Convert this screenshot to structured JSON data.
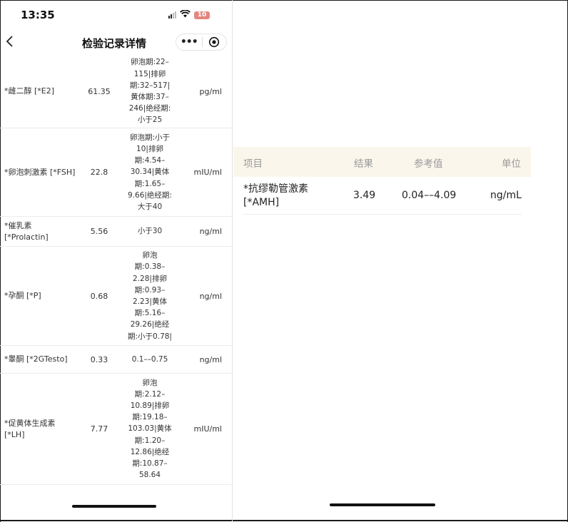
{
  "status": {
    "time": "13:35",
    "battery": "10"
  },
  "nav": {
    "title": "检验记录详情",
    "more_glyph": "•••"
  },
  "rows": [
    {
      "name": "*雌二醇 [*E2]",
      "result": "61.35",
      "ref": [
        "卵泡期:22–",
        "115|排卵",
        "期:32–517|",
        "黄体期:37–",
        "246|绝经期:",
        "小于25"
      ],
      "unit": "pg/ml"
    },
    {
      "name": "*卵泡刺激素 [*FSH]",
      "result": "22.8",
      "ref": [
        "卵泡期:小于",
        "10|排卵",
        "期:4.54–",
        "30.34|黄体",
        "期:1.65–",
        "9.66|绝经期:",
        "大于40"
      ],
      "unit": "mIU/ml"
    },
    {
      "name": "*催乳素 [*Prolactin]",
      "result": "5.56",
      "ref": [
        "小于30"
      ],
      "unit": "ng/ml"
    },
    {
      "name": "*孕酮 [*P]",
      "result": "0.68",
      "ref": [
        "卵泡",
        "期:0.38–",
        "2.28|排卵",
        "期:0.93–",
        "2.23|黄体",
        "期:5.16–",
        "29.26|绝经",
        "期:小于0.78|"
      ],
      "unit": "ng/ml"
    },
    {
      "name": "*睾酮 [*2GTesto]",
      "result": "0.33",
      "ref": [
        "0.1––0.75"
      ],
      "unit": "ng/ml"
    },
    {
      "name": "*促黄体生成素 [*LH]",
      "result": "7.77",
      "ref": [
        "卵泡",
        "期:2.12–",
        "10.89|排卵",
        "期:19.18–",
        "103.03|黄体",
        "期:1.20–",
        "12.86|绝经",
        "期:10.87–",
        "58.64"
      ],
      "unit": "mIU/ml"
    }
  ],
  "right": {
    "headers": {
      "item": "项目",
      "result": "结果",
      "ref": "参考值",
      "unit": "单位"
    },
    "row": {
      "name_line1": "*抗缪勒管激素",
      "name_line2": "[*AMH]",
      "result": "3.49",
      "ref": "0.04––4.09",
      "unit": "ng/mL"
    }
  },
  "colors": {
    "header_bg": "#fbf6ec",
    "battery": "#e4867e"
  }
}
